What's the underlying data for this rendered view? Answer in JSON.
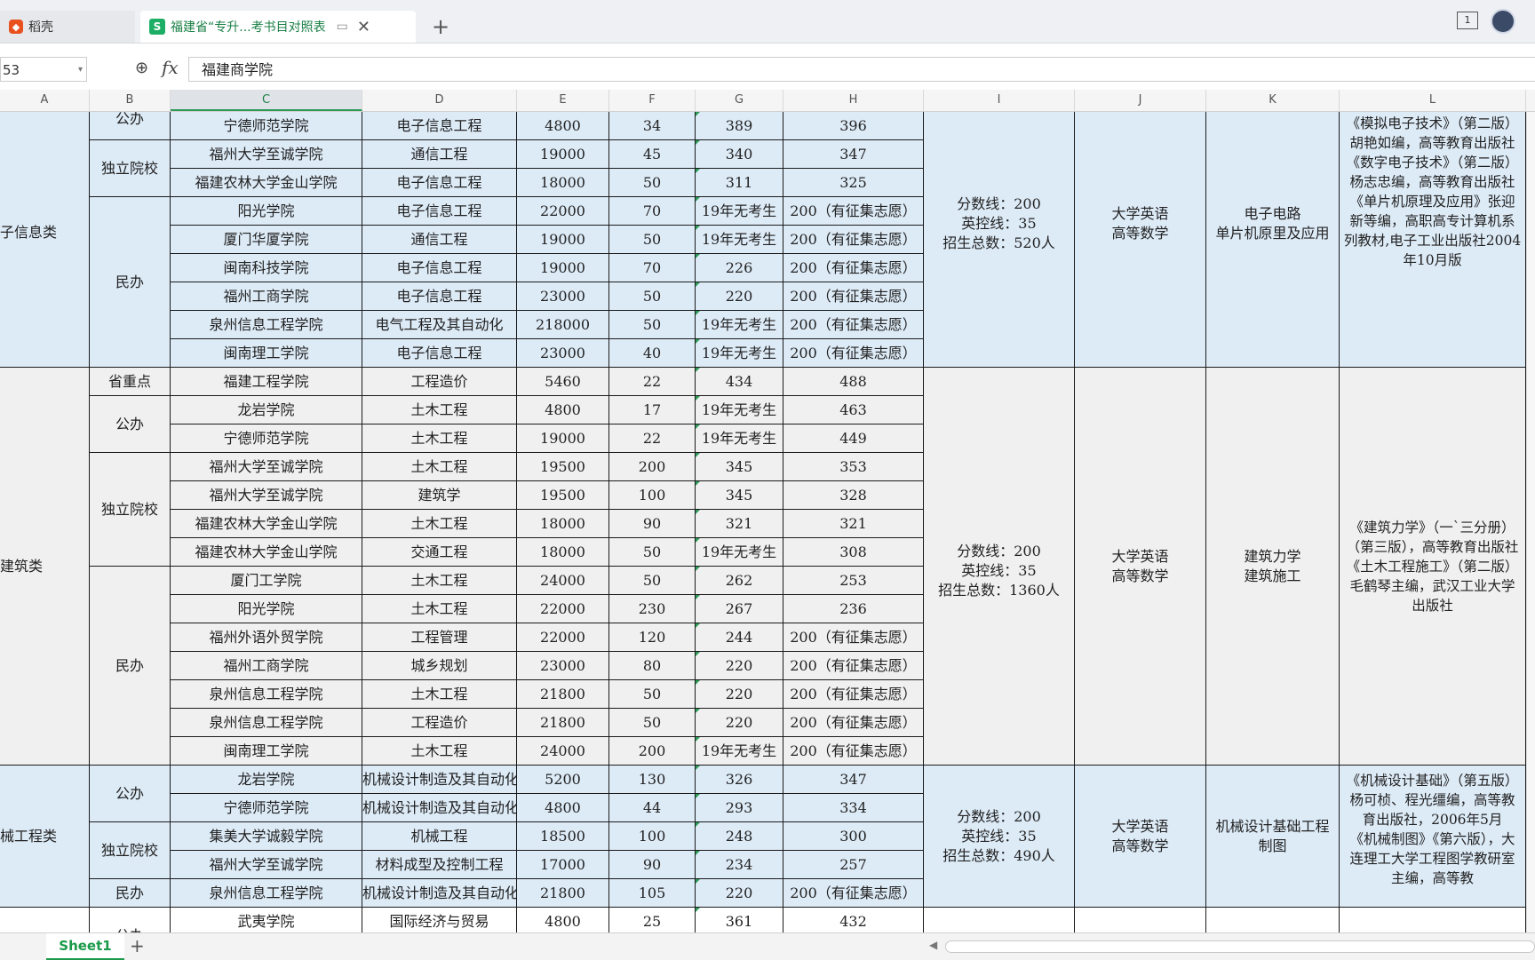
{
  "tabs": {
    "tab1_label": "稻壳",
    "tab2_label": "福建省“专升...考书目对照表",
    "add_label": "+"
  },
  "window": {
    "badge": "1"
  },
  "formula_bar": {
    "name_box": "53",
    "fx": "fx",
    "value": "福建商学院"
  },
  "columns": [
    "A",
    "B",
    "C",
    "D",
    "E",
    "F",
    "G",
    "H",
    "I",
    "J",
    "K",
    "L"
  ],
  "selected_column": "C",
  "sheet": {
    "tab_label": "Sheet1",
    "add_label": "+"
  },
  "groups": [
    {
      "category": "子信息类",
      "info": "分数线：200\n英控线：35\n招生总数：520人",
      "exam": "大学英语\n高等数学",
      "subjects": "电子电路\n单片机原里及应用",
      "bg": "#ddebf7",
      "books": "《模拟电子技术》（第二版）胡艳如编，高等教育出版社\n《数字电子技术》（第二版）杨志忠编，高等教育出版社\n《单片机原理及应用》张迎新等编，高职高专计算机系列教材,电子工业出版社2004年10月版"
    },
    {
      "category": "建筑类",
      "info": "分数线：200\n英控线：35\n招生总数：1360人",
      "exam": "大学英语\n高等数学",
      "subjects": "建筑力学\n建筑施工",
      "bg": "#f0f0f0",
      "books": "《建筑力学》（一`三分册）（第三版），高等教育出版社\n《土木工程施工》（第二版）毛鹤琴主编，武汉工业大学出版社"
    },
    {
      "category": "械工程类",
      "info": "分数线：200\n英控线：35\n招生总数：490人",
      "exam": "大学英语\n高等数学",
      "subjects": "机械设计基础工程制图",
      "bg": "#ddebf7",
      "books": "《机械设计基础》（第五版）杨可桢、程光缰编，高等教育出版社，2006年5月\n《机械制图》《第六版），大连理工大学工程图学教研室主编，高等教"
    }
  ],
  "btypes": [
    {
      "label": "公办"
    },
    {
      "label": "独立院校"
    },
    {
      "label": "民办"
    },
    {
      "label": "省重点"
    },
    {
      "label": "公办"
    },
    {
      "label": "独立院校"
    },
    {
      "label": "民办"
    },
    {
      "label": "公办"
    },
    {
      "label": "独立院校"
    },
    {
      "label": "民办"
    },
    {
      "label": "公办"
    }
  ],
  "rows": [
    {
      "c": "宁德师范学院",
      "d": "电子信息工程",
      "e": "4800",
      "f": "34",
      "g": "389",
      "h": "396"
    },
    {
      "c": "福州大学至诚学院",
      "d": "通信工程",
      "e": "19000",
      "f": "45",
      "g": "340",
      "h": "347"
    },
    {
      "c": "福建农林大学金山学院",
      "d": "电子信息工程",
      "e": "18000",
      "f": "50",
      "g": "311",
      "h": "325"
    },
    {
      "c": "阳光学院",
      "d": "电子信息工程",
      "e": "22000",
      "f": "70",
      "g": "19年无考生",
      "h": "200（有征集志愿）"
    },
    {
      "c": "厦门华厦学院",
      "d": "通信工程",
      "e": "19000",
      "f": "50",
      "g": "19年无考生",
      "h": "200（有征集志愿）"
    },
    {
      "c": "闽南科技学院",
      "d": "电子信息工程",
      "e": "19000",
      "f": "70",
      "g": "226",
      "h": "200（有征集志愿）"
    },
    {
      "c": "福州工商学院",
      "d": "电子信息工程",
      "e": "23000",
      "f": "50",
      "g": "220",
      "h": "200（有征集志愿）"
    },
    {
      "c": "泉州信息工程学院",
      "d": "电气工程及其自动化",
      "e": "218000",
      "f": "50",
      "g": "19年无考生",
      "h": "200（有征集志愿）"
    },
    {
      "c": "闽南理工学院",
      "d": "电子信息工程",
      "e": "23000",
      "f": "40",
      "g": "19年无考生",
      "h": "200（有征集志愿）"
    },
    {
      "c": "福建工程学院",
      "d": "工程造价",
      "e": "5460",
      "f": "22",
      "g": "434",
      "h": "488"
    },
    {
      "c": "龙岩学院",
      "d": "土木工程",
      "e": "4800",
      "f": "17",
      "g": "19年无考生",
      "h": "463"
    },
    {
      "c": "宁德师范学院",
      "d": "土木工程",
      "e": "19000",
      "f": "22",
      "g": "19年无考生",
      "h": "449"
    },
    {
      "c": "福州大学至诚学院",
      "d": "土木工程",
      "e": "19500",
      "f": "200",
      "g": "345",
      "h": "353"
    },
    {
      "c": "福州大学至诚学院",
      "d": "建筑学",
      "e": "19500",
      "f": "100",
      "g": "345",
      "h": "328"
    },
    {
      "c": "福建农林大学金山学院",
      "d": "土木工程",
      "e": "18000",
      "f": "90",
      "g": "321",
      "h": "321"
    },
    {
      "c": "福建农林大学金山学院",
      "d": "交通工程",
      "e": "18000",
      "f": "50",
      "g": "19年无考生",
      "h": "308"
    },
    {
      "c": "厦门工学院",
      "d": "土木工程",
      "e": "24000",
      "f": "50",
      "g": "262",
      "h": "253"
    },
    {
      "c": "阳光学院",
      "d": "土木工程",
      "e": "22000",
      "f": "230",
      "g": "267",
      "h": "236"
    },
    {
      "c": "福州外语外贸学院",
      "d": "工程管理",
      "e": "22000",
      "f": "120",
      "g": "244",
      "h": "200（有征集志愿）"
    },
    {
      "c": "福州工商学院",
      "d": "城乡规划",
      "e": "23000",
      "f": "80",
      "g": "220",
      "h": "200（有征集志愿）"
    },
    {
      "c": "泉州信息工程学院",
      "d": "土木工程",
      "e": "21800",
      "f": "50",
      "g": "220",
      "h": "200（有征集志愿）"
    },
    {
      "c": "泉州信息工程学院",
      "d": "工程造价",
      "e": "21800",
      "f": "50",
      "g": "220",
      "h": "200（有征集志愿）"
    },
    {
      "c": "闽南理工学院",
      "d": "土木工程",
      "e": "24000",
      "f": "200",
      "g": "19年无考生",
      "h": "200（有征集志愿）"
    },
    {
      "c": "龙岩学院",
      "d": "机械设计制造及其自动化",
      "e": "5200",
      "f": "130",
      "g": "326",
      "h": "347"
    },
    {
      "c": "宁德师范学院",
      "d": "机械设计制造及其自动化",
      "e": "4800",
      "f": "44",
      "g": "293",
      "h": "334"
    },
    {
      "c": "集美大学诚毅学院",
      "d": "机械工程",
      "e": "18500",
      "f": "100",
      "g": "248",
      "h": "300"
    },
    {
      "c": "福州大学至诚学院",
      "d": "材料成型及控制工程",
      "e": "17000",
      "f": "90",
      "g": "234",
      "h": "257"
    },
    {
      "c": "泉州信息工程学院",
      "d": "机械设计制造及其自动化",
      "e": "21800",
      "f": "105",
      "g": "220",
      "h": "200（有征集志愿）"
    },
    {
      "c": "武夷学院",
      "d": "国际经济与贸易",
      "e": "4800",
      "f": "25",
      "g": "361",
      "h": "432"
    }
  ]
}
